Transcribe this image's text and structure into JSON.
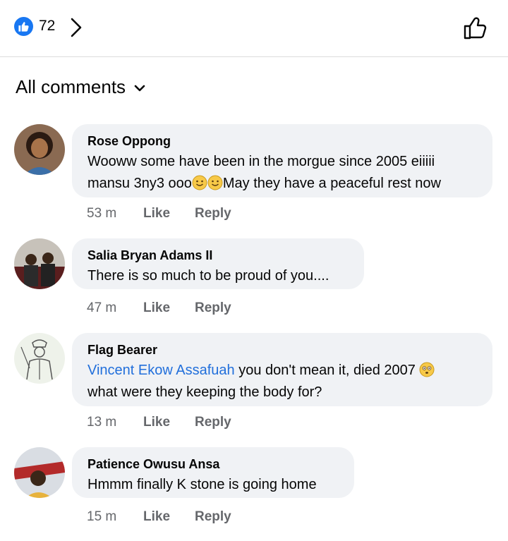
{
  "header": {
    "reaction_count": "72",
    "colors": {
      "accent": "#1877f2",
      "bubble": "#f0f2f5",
      "mention": "#216fdb",
      "meta": "#65676b"
    },
    "icons": [
      "thumbs-up-badge-icon",
      "chevron-right-icon",
      "thumbs-up-outline-icon"
    ]
  },
  "sort": {
    "label": "All comments",
    "icon": "chevron-down-icon"
  },
  "comments": [
    {
      "author": "Rose Oppong",
      "line1": "Wooww some have been in the morgue since 2005 eiiiii",
      "line2_prefix": "mansu 3ny3 ooo",
      "line2_suffix": "May they have a peaceful rest now",
      "emojis": [
        "smile-emoji",
        "smile-emoji"
      ],
      "time": "53 m",
      "like": "Like",
      "reply": "Reply"
    },
    {
      "author": "Salia Bryan Adams II",
      "line1": "There is so much to be proud of you....",
      "time": "47 m",
      "like": "Like",
      "reply": "Reply"
    },
    {
      "author": "Flag Bearer",
      "mention": "Vincent Ekow Assafuah",
      "line1_suffix": " you don't mean it, died 2007 ",
      "line2": "what were they keeping the body for?",
      "emojis": [
        "flushed-emoji"
      ],
      "time": "13 m",
      "like": "Like",
      "reply": "Reply"
    },
    {
      "author": "Patience Owusu Ansa",
      "line1": "Hmmm finally K stone is going home",
      "time": "15 m",
      "like": "Like",
      "reply": "Reply"
    }
  ]
}
